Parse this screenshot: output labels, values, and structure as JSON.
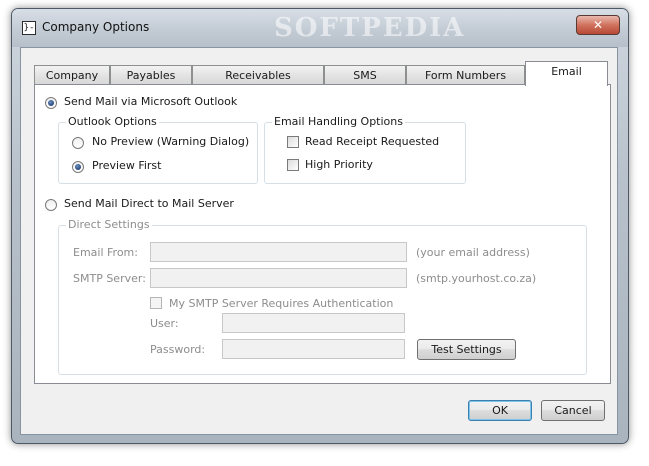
{
  "window": {
    "title": "Company Options",
    "watermark": "SOFTPEDIA",
    "close_glyph": "✕",
    "sys_icon_glyph": "}-"
  },
  "tabs": [
    {
      "label": "Company"
    },
    {
      "label": "Payables"
    },
    {
      "label": "Receivables"
    },
    {
      "label": "SMS"
    },
    {
      "label": "Form Numbers"
    },
    {
      "label": "Email",
      "active": true
    }
  ],
  "email": {
    "send_outlook": {
      "label": "Send Mail via Microsoft Outlook",
      "checked": true
    },
    "outlook_options": {
      "title": "Outlook Options",
      "no_preview": {
        "label": "No Preview (Warning Dialog)",
        "checked": false
      },
      "preview_first": {
        "label": "Preview First",
        "checked": true
      }
    },
    "handling_options": {
      "title": "Email Handling Options",
      "read_receipt": {
        "label": "Read Receipt Requested",
        "checked": false
      },
      "high_priority": {
        "label": "High Priority",
        "checked": false
      }
    },
    "send_direct": {
      "label": "Send Mail Direct to Mail Server",
      "checked": false
    },
    "direct_settings": {
      "title": "Direct Settings",
      "email_from": {
        "label": "Email From:",
        "value": "",
        "hint": "(your email address)"
      },
      "smtp_server": {
        "label": "SMTP Server:",
        "value": "",
        "hint": "(smtp.yourhost.co.za)"
      },
      "auth": {
        "label": "My SMTP Server Requires Authentication",
        "checked": false
      },
      "user": {
        "label": "User:",
        "value": ""
      },
      "password": {
        "label": "Password:",
        "value": ""
      },
      "test_button": "Test Settings"
    }
  },
  "footer": {
    "ok": "OK",
    "cancel": "Cancel"
  }
}
